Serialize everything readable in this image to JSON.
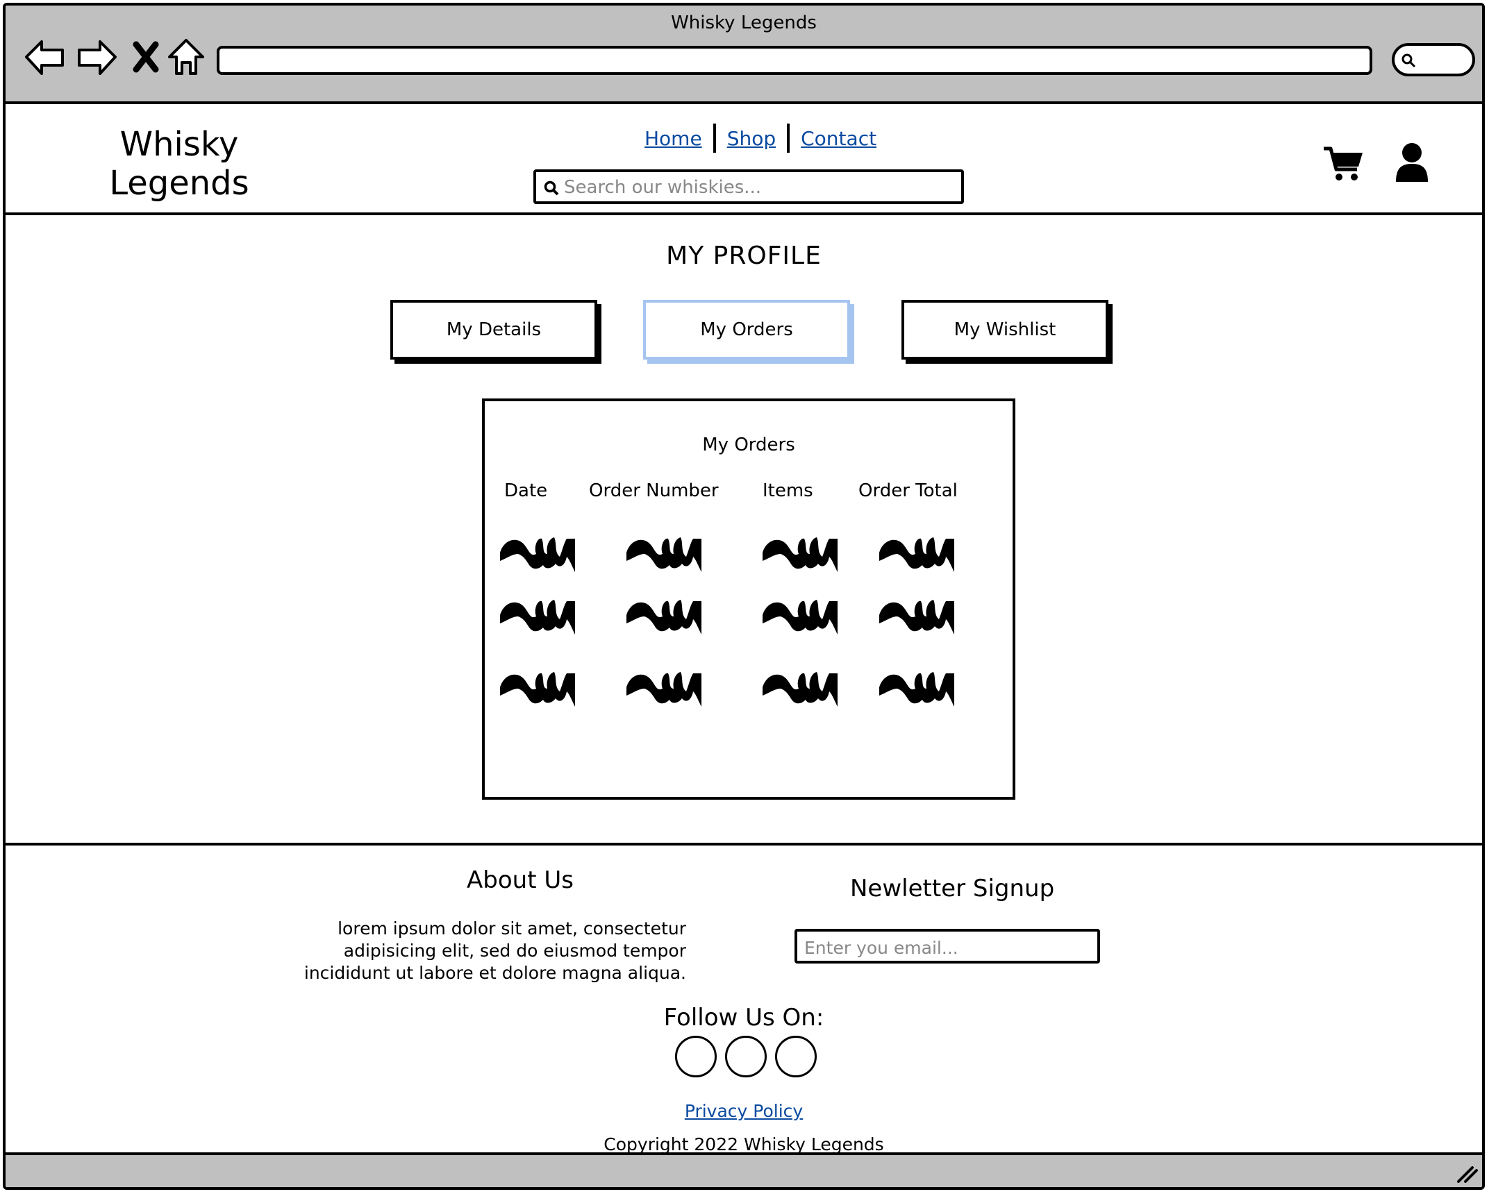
{
  "window": {
    "title": "Whisky Legends"
  },
  "header": {
    "logo": "Whisky Legends",
    "nav": [
      "Home",
      "Shop",
      "Contact"
    ],
    "search_placeholder": "Search our whiskies..."
  },
  "profile": {
    "title": "MY PROFILE",
    "tabs": [
      {
        "label": "My Details",
        "active": false
      },
      {
        "label": "My Orders",
        "active": true
      },
      {
        "label": "My Wishlist",
        "active": false
      }
    ]
  },
  "orders": {
    "title": "My Orders",
    "columns": [
      "Date",
      "Order Number",
      "Items",
      "Order Total"
    ]
  },
  "footer": {
    "about_title": "About Us",
    "about_text": "lorem ipsum dolor sit amet, consectetur adipisicing elit, sed do eiusmod tempor incididunt ut labore et dolore magna aliqua.",
    "newsletter_title": "Newletter Signup",
    "email_placeholder": "Enter you email...",
    "follow": "Follow Us On:",
    "privacy": "Privacy Policy",
    "copyright": "Copyright 2022 Whisky Legends"
  }
}
